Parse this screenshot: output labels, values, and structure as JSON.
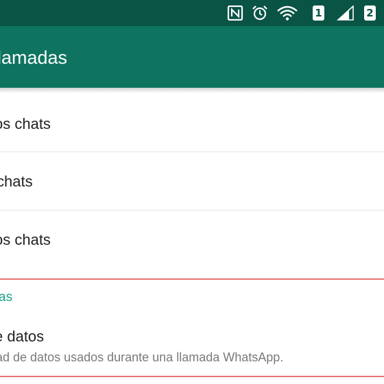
{
  "status_bar": {
    "sim1_label": "1",
    "sim2_label": "2",
    "icons": [
      "nfc-icon",
      "alarm-icon",
      "wifi-icon",
      "sim1-icon",
      "signal-icon",
      "sim2-icon"
    ]
  },
  "toolbar": {
    "title": "llamadas"
  },
  "items": [
    {
      "label": "os chats"
    },
    {
      "label": " chats"
    },
    {
      "label": "os chats"
    }
  ],
  "calls_section": {
    "header": "as",
    "low_data": {
      "title": "e datos",
      "subtitle": "ad de datos usados durante una llamada WhatsApp."
    }
  },
  "colors": {
    "status_bar": "#0a5446",
    "toolbar": "#0e7460",
    "accent": "#1aa38c",
    "highlight_border": "#e57373"
  }
}
